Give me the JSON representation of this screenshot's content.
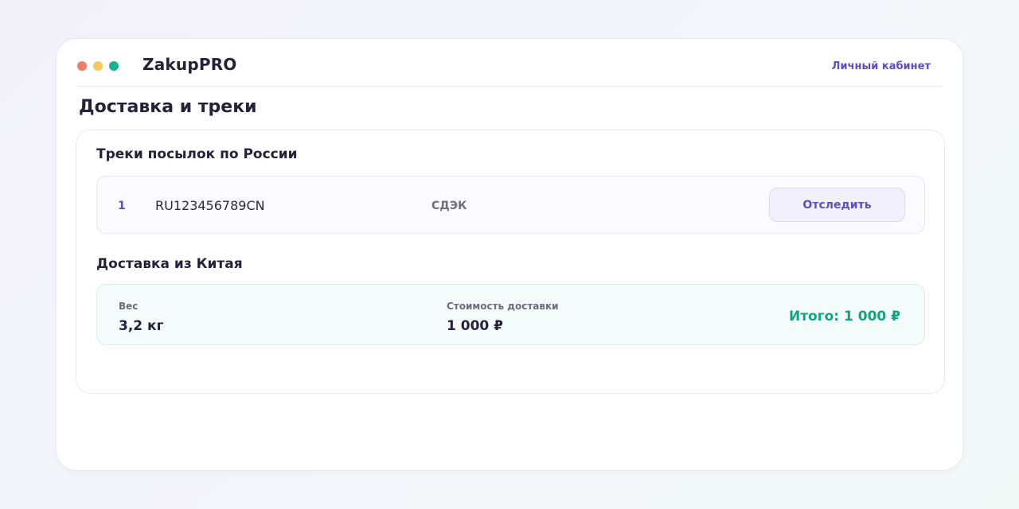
{
  "app": {
    "brand": "ZakupPRO",
    "account_link": "Личный кабинет"
  },
  "window_controls": [
    {
      "name": "close",
      "color": "#f17c6c"
    },
    {
      "name": "minimize",
      "color": "#f7c85a"
    },
    {
      "name": "maximize",
      "color": "#17b28f"
    }
  ],
  "page": {
    "title": "Доставка и треки"
  },
  "tracks_section": {
    "title": "Треки посылок по России",
    "items": [
      {
        "num": "1",
        "code": "RU123456789CN",
        "carrier": "СДЭК",
        "button": "Отследить"
      }
    ]
  },
  "china_delivery": {
    "title": "Доставка из Китая",
    "weight_label": "Вес",
    "weight_value": "3,2 кг",
    "cost_label": "Стоимость доставки",
    "cost_value": "1 000 ₽",
    "total": "Итого: 1 000 ₽"
  },
  "colors": {
    "accent": "#5b4fc4",
    "total": "#12a37f"
  }
}
